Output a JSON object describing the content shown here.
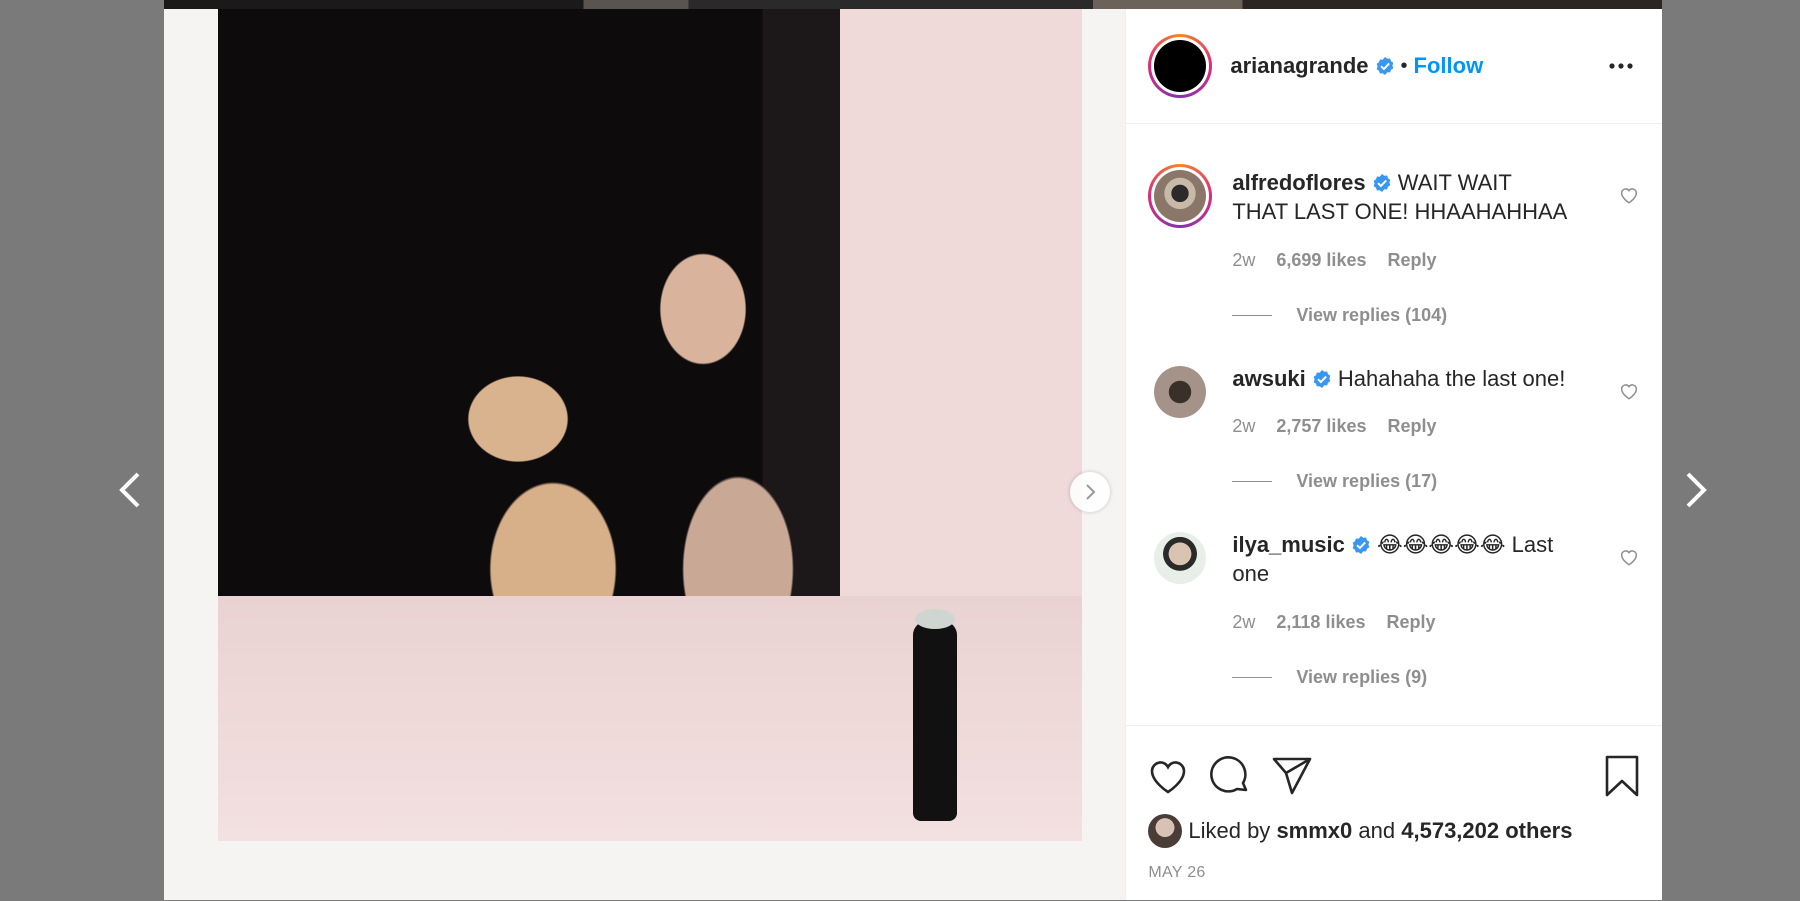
{
  "post": {
    "author": "arianagrande",
    "follow_label": "Follow",
    "dot": "•"
  },
  "comments": [
    {
      "user": "alfredoflores",
      "text": "WAIT WAIT THAT LAST ONE! HHAAHAHHAA",
      "age": "2w",
      "likes": "6,699 likes",
      "reply": "Reply",
      "view_replies": "View replies (104)"
    },
    {
      "user": "awsuki",
      "text": "Hahahaha the last one!",
      "age": "2w",
      "likes": "2,757 likes",
      "reply": "Reply",
      "view_replies": "View replies (17)"
    },
    {
      "user": "ilya_music",
      "emojis": "😂😂😂😂😂",
      "text": "Last one",
      "age": "2w",
      "likes": "2,118 likes",
      "reply": "Reply",
      "view_replies": "View replies (9)"
    }
  ],
  "likes_summary": {
    "prefix": "Liked by",
    "user": "smmx0",
    "conjunction": "and",
    "others": "4,573,202 others"
  },
  "date": "MAY 26",
  "icons": {
    "verified": "verified-badge-icon",
    "more": "more-options-icon",
    "heart": "heart-icon",
    "comment": "comment-icon",
    "share": "share-icon",
    "save": "bookmark-icon",
    "prev": "chevron-left-icon",
    "next": "chevron-right-icon"
  },
  "colors": {
    "link": "#0095f6",
    "verified": "#3897f0",
    "text": "#262626",
    "muted": "#8e8e8e"
  }
}
